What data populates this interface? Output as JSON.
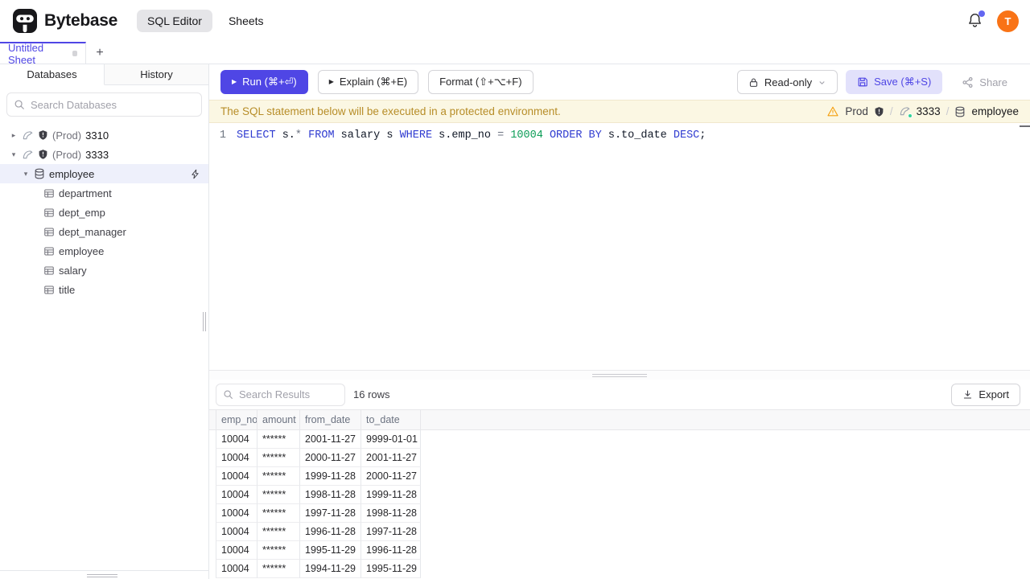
{
  "header": {
    "brand": "Bytebase",
    "nav": [
      {
        "label": "SQL Editor",
        "active": true
      },
      {
        "label": "Sheets",
        "active": false
      }
    ],
    "notifications": {
      "has_unread": true
    },
    "avatar_initial": "T"
  },
  "sheet_tabs": {
    "active_tab": "Untitled Sheet",
    "add_tab_label": "+"
  },
  "sidebar": {
    "tabs": [
      {
        "label": "Databases",
        "active": true
      },
      {
        "label": "History",
        "active": false
      }
    ],
    "search_placeholder": "Search Databases",
    "tree": [
      {
        "kind": "instance",
        "expanded": false,
        "env": "(Prod)",
        "name": "3310"
      },
      {
        "kind": "instance",
        "expanded": true,
        "env": "(Prod)",
        "name": "3333"
      },
      {
        "kind": "database",
        "expanded": true,
        "name": "employee",
        "selected": true
      },
      {
        "kind": "table",
        "name": "department"
      },
      {
        "kind": "table",
        "name": "dept_emp"
      },
      {
        "kind": "table",
        "name": "dept_manager"
      },
      {
        "kind": "table",
        "name": "employee"
      },
      {
        "kind": "table",
        "name": "salary"
      },
      {
        "kind": "table",
        "name": "title"
      }
    ]
  },
  "toolbar": {
    "run_label": "Run (⌘+⏎)",
    "explain_label": "Explain (⌘+E)",
    "format_label": "Format (⇧+⌥+F)",
    "readonly_label": "Read-only",
    "save_label": "Save (⌘+S)",
    "share_label": "Share"
  },
  "banner": {
    "message": "The SQL statement below will be executed in a protected environment.",
    "environment": "Prod",
    "instance": "3333",
    "database": "employee",
    "separator": "/"
  },
  "editor": {
    "line_number": "1",
    "sql": "SELECT s.* FROM salary s WHERE s.emp_no = 10004 ORDER BY s.to_date DESC;",
    "tokens": [
      [
        "SELECT",
        "kw"
      ],
      [
        " s.",
        "pl"
      ],
      [
        "*",
        "op"
      ],
      [
        " ",
        "pl"
      ],
      [
        "FROM",
        "kw"
      ],
      [
        " salary s ",
        "pl"
      ],
      [
        "WHERE",
        "kw"
      ],
      [
        " s.emp_no ",
        "pl"
      ],
      [
        "=",
        "op"
      ],
      [
        " ",
        "pl"
      ],
      [
        "10004",
        "num"
      ],
      [
        " ",
        "pl"
      ],
      [
        "ORDER BY",
        "kw"
      ],
      [
        " s.to_date ",
        "pl"
      ],
      [
        "DESC",
        "kw"
      ],
      [
        ";",
        "pl"
      ]
    ]
  },
  "results": {
    "search_placeholder": "Search Results",
    "row_count": "16 rows",
    "export_label": "Export",
    "columns": [
      "emp_no",
      "amount",
      "from_date",
      "to_date"
    ],
    "rows": [
      [
        "10004",
        "******",
        "2001-11-27",
        "9999-01-01"
      ],
      [
        "10004",
        "******",
        "2000-11-27",
        "2001-11-27"
      ],
      [
        "10004",
        "******",
        "1999-11-28",
        "2000-11-27"
      ],
      [
        "10004",
        "******",
        "1998-11-28",
        "1999-11-28"
      ],
      [
        "10004",
        "******",
        "1997-11-28",
        "1998-11-28"
      ],
      [
        "10004",
        "******",
        "1996-11-28",
        "1997-11-28"
      ],
      [
        "10004",
        "******",
        "1995-11-29",
        "1996-11-28"
      ],
      [
        "10004",
        "******",
        "1994-11-29",
        "1995-11-29"
      ]
    ]
  },
  "colors": {
    "accent": "#4f46e5",
    "accent_light": "#e2e1fb",
    "avatar_orange": "#f97316",
    "badge_purple": "#6366f1",
    "banner_bg": "#fbf7e3",
    "banner_text": "#b78d28",
    "warning_orange": "#f59e0b",
    "status_green": "#34d399",
    "kw_blue": "#2f3bd0",
    "num_green": "#0c9d57"
  }
}
